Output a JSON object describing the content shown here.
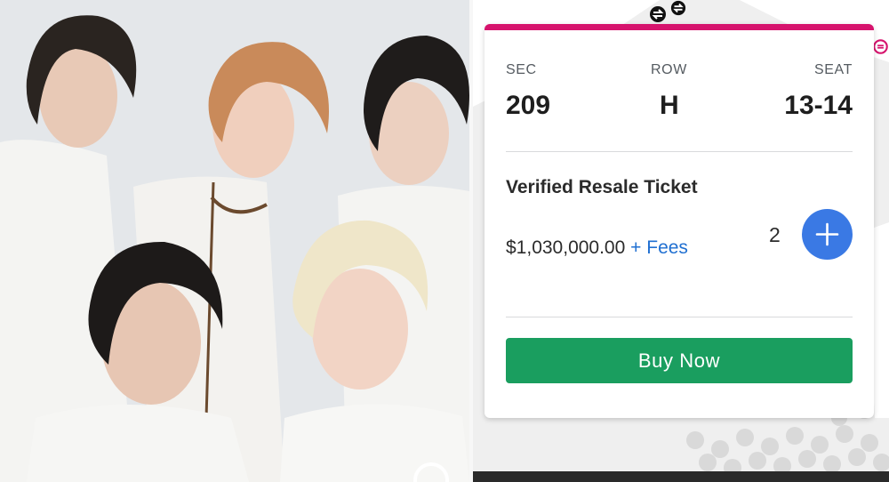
{
  "photo": {
    "icon": "group-photo-image"
  },
  "ticket": {
    "labels": {
      "section": "SEC",
      "row": "ROW",
      "seat": "SEAT"
    },
    "values": {
      "section": "209",
      "row": "H",
      "seat": "13-14"
    },
    "type_label": "Verified Resale Ticket",
    "price": "$1,030,000.00",
    "fees_text": "+ Fees",
    "quantity": "2",
    "buy_label": "Buy Now"
  },
  "colors": {
    "accent": "#d6136d",
    "buy_button": "#1a9e5f",
    "plus_button": "#3a79e4",
    "link": "#1f6fd1"
  },
  "icons": {
    "plus": "plus-icon",
    "accessibility": "swap-icon"
  }
}
